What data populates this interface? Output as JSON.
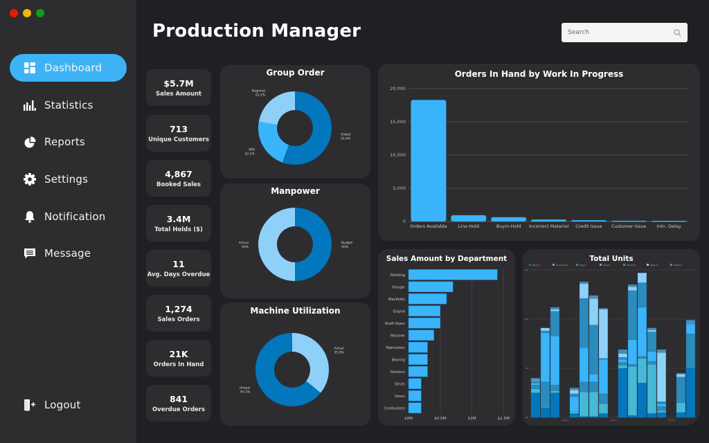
{
  "window": {
    "controls": [
      {
        "name": "close",
        "color": "#e8180c"
      },
      {
        "name": "minimize",
        "color": "#f4b400"
      },
      {
        "name": "maximize",
        "color": "#0f9d1a"
      }
    ]
  },
  "sidebar": {
    "items": [
      {
        "label": "Dashboard",
        "icon": "dashboard-icon",
        "active": true
      },
      {
        "label": "Statistics",
        "icon": "bar-chart-icon",
        "active": false
      },
      {
        "label": "Reports",
        "icon": "pie-chart-icon",
        "active": false
      },
      {
        "label": "Settings",
        "icon": "gear-icon",
        "active": false
      },
      {
        "label": "Notification",
        "icon": "bell-icon",
        "active": false
      },
      {
        "label": "Message",
        "icon": "message-icon",
        "active": false
      }
    ],
    "logout": {
      "label": "Logout",
      "icon": "logout-icon"
    }
  },
  "header": {
    "title": "Production Manager",
    "search_placeholder": "Search",
    "search_value": ""
  },
  "kpis": [
    {
      "value": "$5.7M",
      "label": "Sales Amount"
    },
    {
      "value": "713",
      "label": "Unique Customers"
    },
    {
      "value": "4,867",
      "label": "Booked Sales"
    },
    {
      "value": "3.4M",
      "label": "Total Holds ($)"
    },
    {
      "value": "11",
      "label": "Avg. Days Overdue"
    },
    {
      "value": "1,274",
      "label": "Sales Orders"
    },
    {
      "value": "21K",
      "label": "Orders In Hand"
    },
    {
      "value": "841",
      "label": "Overdue Orders"
    }
  ],
  "colors": {
    "accent": "#3db3f6",
    "dark_blue": "#0277bd",
    "light_blue": "#8fd0f8",
    "mid_blue": "#3ab4fb",
    "teal": "#45b9d6",
    "steel": "#2b8bbd",
    "card": "#2d2d30",
    "bg": "#1f2023"
  },
  "chart_data": [
    {
      "id": "group-order",
      "type": "pie",
      "title": "Group Order",
      "slices": [
        {
          "label": "Global",
          "value": 55.6,
          "display": "55.6%",
          "color": "#0277bd"
        },
        {
          "label": "WIS",
          "value": 22.2,
          "display": "22.2%",
          "color": "#3ab4fb"
        },
        {
          "label": "Regional",
          "value": 22.2,
          "display": "22.2%",
          "color": "#8fd0f8"
        }
      ]
    },
    {
      "id": "manpower",
      "type": "pie",
      "title": "Manpower",
      "slices": [
        {
          "label": "Budget",
          "value": 50,
          "display": "50%",
          "color": "#0277bd"
        },
        {
          "label": "Actual",
          "value": 50,
          "display": "50%",
          "color": "#8fd0f8"
        }
      ]
    },
    {
      "id": "machine-utilization",
      "type": "pie",
      "title": "Machine Utilization",
      "slices": [
        {
          "label": "Actual",
          "value": 35.9,
          "display": "35.9%",
          "color": "#8fd0f8"
        },
        {
          "label": "Unique",
          "value": 64.1,
          "display": "64.1%",
          "color": "#0277bd"
        }
      ]
    },
    {
      "id": "orders-in-hand",
      "type": "bar",
      "title": "Orders In Hand by Work In Progress",
      "categories": [
        "Orders Available",
        "Line Hold",
        "Buyin-Hold",
        "Incorrect Material",
        "Credit Issue",
        "Customer Issue",
        "Intn. Delay"
      ],
      "values": [
        18300,
        950,
        650,
        300,
        200,
        120,
        100
      ],
      "yticks": [
        0,
        5000,
        10000,
        15000,
        20000
      ],
      "ytick_labels": [
        "0",
        "5,000",
        "10,000",
        "15,000",
        "20,000"
      ],
      "ylim": [
        0,
        20000
      ],
      "grid": true,
      "color": "#3ab4fb"
    },
    {
      "id": "sales-by-department",
      "type": "bar",
      "orientation": "horizontal",
      "title": "Sales Amount by Department",
      "categories": [
        "Rotating",
        "Hanger",
        "Manifolds",
        "Engine",
        "Shaft Gears",
        "Retainer",
        "Fabrication",
        "Bearing",
        "Rotators",
        "Struts",
        "Vanes",
        "Combusters"
      ],
      "values": [
        1.4,
        0.7,
        0.6,
        0.5,
        0.5,
        0.4,
        0.3,
        0.3,
        0.3,
        0.2,
        0.2,
        0.2
      ],
      "xticks": [
        0,
        0.5,
        1,
        1.5
      ],
      "xtick_labels": [
        "$0M",
        "$0.5M",
        "$1M",
        "$1.5M"
      ],
      "xlim": [
        0,
        1.55
      ],
      "grid": true,
      "color": "#3ab4fb"
    },
    {
      "id": "total-units",
      "type": "bar",
      "stacked": true,
      "title": "Total Units",
      "legend": "top",
      "series_names": [
        "Bearing",
        "Combusters",
        "Engine",
        "Hanger",
        "Manifolds",
        "Retainer",
        "Rotating"
      ],
      "series_colors": [
        "#0277bd",
        "#45b9d6",
        "#2b8bbd",
        "#3ab4fb",
        "#2b8bbd",
        "#8fd0f8",
        "#4a8fb5"
      ],
      "yticks": [
        0,
        5,
        10,
        15
      ],
      "ytick_labels": [
        "0k",
        "5k",
        "10k",
        "15k"
      ],
      "ylim": [
        0,
        15
      ],
      "xtick_labels": [
        "05 Jan",
        "12 Jan",
        "19 Jan"
      ],
      "bars": [
        [
          2.5,
          0.4,
          0.4,
          0.2,
          0.2,
          0.1,
          0.2
        ],
        [
          1.0,
          0.1,
          2.5,
          5.0,
          0.2,
          0.3,
          0.0
        ],
        [
          2.5,
          0.2,
          0.6,
          5.0,
          2.5,
          0.2,
          0.2
        ],
        [],
        [
          0.4,
          0.2,
          0.0,
          1.5,
          0.3,
          0.4,
          0.2
        ],
        [
          0.1,
          2.5,
          1.0,
          3.5,
          5.0,
          1.5,
          0.2
        ],
        [
          0.1,
          2.5,
          1.0,
          0.8,
          5.0,
          2.7,
          0.3
        ],
        [
          0.4,
          1.0,
          1.0,
          3.5,
          0.1,
          5.0,
          0.1
        ],
        [],
        [
          5.0,
          0.3,
          0.3,
          0.3,
          0.2,
          0.4,
          0.4
        ],
        [
          0.2,
          5.0,
          0.2,
          2.5,
          5.0,
          0.4,
          0.2
        ],
        [
          3.5,
          2.5,
          0.2,
          5.0,
          2.5,
          1.0,
          0.0
        ],
        [
          0.4,
          5.0,
          0.3,
          1.0,
          2.0,
          0.2,
          0.2
        ],
        [
          0.5,
          0.2,
          0.4,
          0.3,
          0.2,
          5.0,
          0.3
        ],
        [],
        [
          0.5,
          1.0,
          2.5,
          0.0,
          0.1,
          0.3,
          0.1
        ],
        [
          5.0,
          0.0,
          3.5,
          1.0,
          0.0,
          0.0,
          0.4
        ]
      ]
    }
  ]
}
